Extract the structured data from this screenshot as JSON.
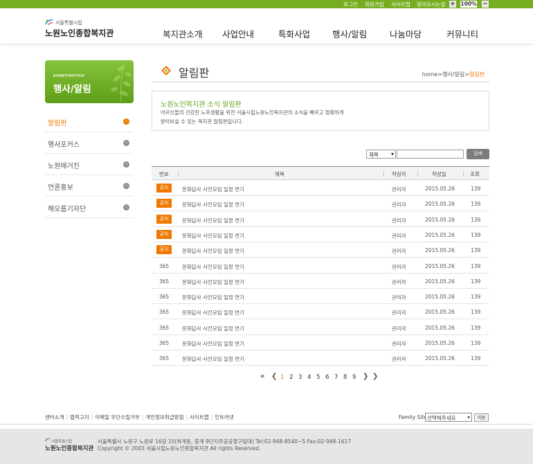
{
  "top_util": {
    "login": "로그인",
    "join": "회원가입",
    "sitemap": "사이트맵",
    "directions": "찾아오시는길",
    "zoom_in": "+",
    "zoom_level": "100%",
    "zoom_out": "−"
  },
  "logo": {
    "sub": "서울특별시립",
    "name": "노원노인종합복지관"
  },
  "gnb": [
    "복지관소개",
    "사업안내",
    "특화사업",
    "행사/알림",
    "나눔마당",
    "커뮤니티"
  ],
  "lnb": {
    "banner_en": "EVENT/NOTICE",
    "banner_title": "행사/알림",
    "items": [
      "알림판",
      "행사포커스",
      "노원매거진",
      "언론홍보",
      "해오름기자단"
    ]
  },
  "page": {
    "title": "알림판",
    "breadcrumb_home": "home",
    "breadcrumb_mid": "행사/알림",
    "breadcrumb_current": "알림판"
  },
  "intro": {
    "heading": "노원노인복지관 소식 알림판",
    "line1": "어르신들의 건강한 노후생활을 위한 서울시립노원노인복지관의 소식을 빠르고 정확하게",
    "line2": "받아보실 수 있는 복지관 알림판입니다."
  },
  "search": {
    "select_value": "제목",
    "input_value": "",
    "button": "검색"
  },
  "table": {
    "headers": [
      "번호",
      "제목",
      "작성자",
      "작성일",
      "조회"
    ],
    "rows": [
      {
        "num": "공지",
        "notice": true,
        "title": "문화답사 사전모임 일정 연기",
        "author": "관리자",
        "date": "2015.05.26",
        "views": "139"
      },
      {
        "num": "공지",
        "notice": true,
        "title": "문화답사 사전모임 일정 연기",
        "author": "관리자",
        "date": "2015.05.26",
        "views": "139"
      },
      {
        "num": "공지",
        "notice": true,
        "title": "문화답사 사전모임 일정 연기",
        "author": "관리자",
        "date": "2015.05.26",
        "views": "139"
      },
      {
        "num": "공지",
        "notice": true,
        "title": "문화답사 사전모임 일정 연기",
        "author": "관리자",
        "date": "2015.05.26",
        "views": "139"
      },
      {
        "num": "공지",
        "notice": true,
        "title": "문화답사 사전모임 일정 연기",
        "author": "관리자",
        "date": "2015.05.26",
        "views": "139"
      },
      {
        "num": "365",
        "notice": false,
        "title": "문화답사 사전모임 일정 연기",
        "author": "관리자",
        "date": "2015.05.26",
        "views": "139"
      },
      {
        "num": "365",
        "notice": false,
        "title": "문화답사 사전모임 일정 연기",
        "author": "관리자",
        "date": "2015.05.26",
        "views": "139"
      },
      {
        "num": "365",
        "notice": false,
        "title": "문화답사 사전모임 일정 연기",
        "author": "관리자",
        "date": "2015.05.26",
        "views": "139"
      },
      {
        "num": "365",
        "notice": false,
        "title": "문화답사 사전모임 일정 연기",
        "author": "관리자",
        "date": "2015.05.26",
        "views": "139"
      },
      {
        "num": "365",
        "notice": false,
        "title": "문화답사 사전모임 일정 연기",
        "author": "관리자",
        "date": "2015.05.26",
        "views": "139"
      },
      {
        "num": "365",
        "notice": false,
        "title": "문화답사 사전모임 일정 연기",
        "author": "관리자",
        "date": "2015.05.26",
        "views": "139"
      },
      {
        "num": "365",
        "notice": false,
        "title": "문화답사 사전모임 일정 연기",
        "author": "관리자",
        "date": "2015.05.26",
        "views": "139"
      }
    ]
  },
  "pager": {
    "first": "❮",
    "prev": "❮",
    "pages": [
      "1",
      "2",
      "3",
      "4",
      "5",
      "6",
      "7",
      "8",
      "9"
    ],
    "current": "1",
    "next": "❯",
    "last": "❯"
  },
  "footer": {
    "links": [
      "센터소개",
      "법적고지",
      "이메일 무단수집거부",
      "개인정보취급방침",
      "사이트맵",
      "인트라넷"
    ],
    "family_label": "Famliy Site",
    "family_select": "선택해주세요",
    "family_go": "이동",
    "logo_sub": "서울특별시립",
    "logo_name": "노원노인종합복지관",
    "address": "서울특별시 노원구 노원로 16길 15(하계동, 중계 9단지주공공영구임대) Tel:02-948-8540~5 Fax:02-948-1617",
    "copyright": "Copyright © 2003 서울시립노원노인종합복지관 All rights Reserved."
  },
  "colors": {
    "brand_green": "#77ae21",
    "accent_orange": "#f07800"
  }
}
